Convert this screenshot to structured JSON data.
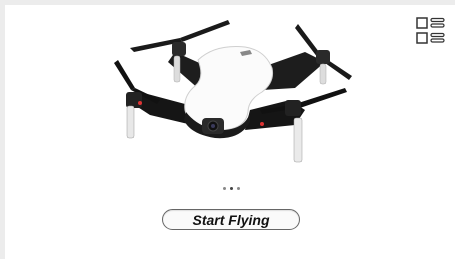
{
  "start_button": {
    "label": "Start Flying"
  },
  "carousel": {
    "count": 3,
    "active_index": 1
  },
  "icons": {
    "menu": "list-view-icon",
    "product": "drone-image"
  },
  "colors": {
    "background": "#ececec",
    "panel": "#ffffff",
    "button_border": "#666666"
  }
}
